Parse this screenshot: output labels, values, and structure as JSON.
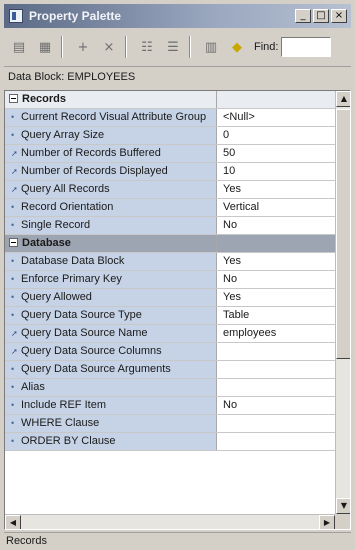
{
  "window": {
    "title": "Property Palette",
    "buttons": {
      "minimize": "_",
      "maximize": "□",
      "close": "×"
    }
  },
  "toolbar": {
    "icons": [
      "copy-properties-icon",
      "paste-properties-icon",
      "add-property-icon",
      "delete-property-icon",
      "union-icon",
      "intersection-icon",
      "freeze-icon",
      "inherit-icon"
    ],
    "find_label": "Find:",
    "find_value": ""
  },
  "context": {
    "label": "Data Block: EMPLOYEES"
  },
  "properties": {
    "records_header": "Records",
    "records": [
      {
        "name": "Current Record Visual Attribute Group",
        "value": "<Null>",
        "marker": "dot"
      },
      {
        "name": "Query Array Size",
        "value": "0",
        "marker": "dot"
      },
      {
        "name": "Number of Records Buffered",
        "value": "50",
        "marker": "mark"
      },
      {
        "name": "Number of Records Displayed",
        "value": "10",
        "marker": "mark"
      },
      {
        "name": "Query All Records",
        "value": "Yes",
        "marker": "mark"
      },
      {
        "name": "Record Orientation",
        "value": "Vertical",
        "marker": "dot"
      },
      {
        "name": "Single Record",
        "value": "No",
        "marker": "dot"
      }
    ],
    "database_header": "Database",
    "database": [
      {
        "name": "Database Data Block",
        "value": "Yes",
        "marker": "dot"
      },
      {
        "name": "Enforce Primary Key",
        "value": "No",
        "marker": "dot"
      },
      {
        "name": "Query Allowed",
        "value": "Yes",
        "marker": "dot"
      },
      {
        "name": "Query Data Source Type",
        "value": "Table",
        "marker": "dot"
      },
      {
        "name": "Query Data Source Name",
        "value": "employees",
        "marker": "mark"
      },
      {
        "name": "Query Data Source Columns",
        "value": "",
        "marker": "mark"
      },
      {
        "name": "Query Data Source Arguments",
        "value": "",
        "marker": "dot"
      },
      {
        "name": "Alias",
        "value": "",
        "marker": "dot"
      },
      {
        "name": "Include REF Item",
        "value": "No",
        "marker": "dot"
      },
      {
        "name": "WHERE Clause",
        "value": "",
        "marker": "dot"
      },
      {
        "name": "ORDER BY Clause",
        "value": "",
        "marker": "dot"
      }
    ]
  },
  "status": {
    "text": "Records"
  }
}
